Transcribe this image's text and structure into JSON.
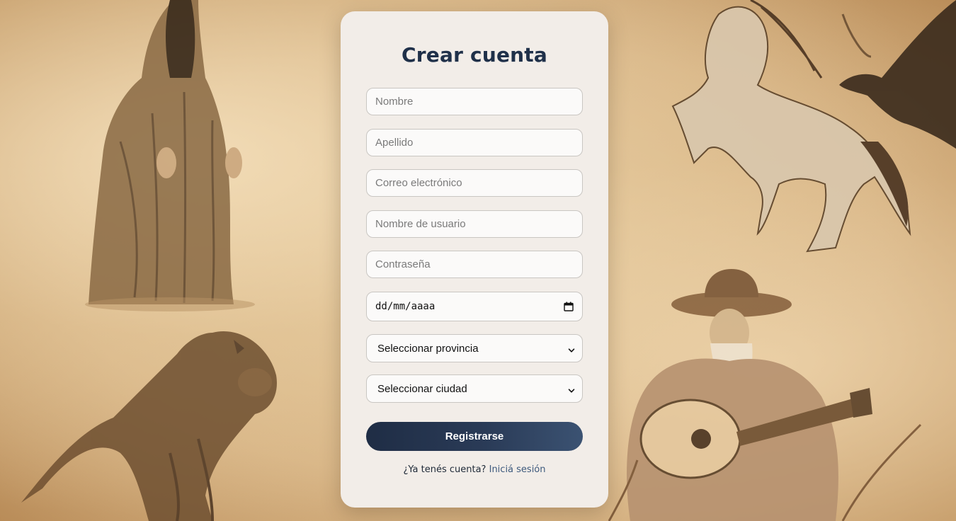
{
  "form": {
    "title": "Crear cuenta",
    "fields": {
      "first_name": {
        "placeholder": "Nombre",
        "value": ""
      },
      "last_name": {
        "placeholder": "Apellido",
        "value": ""
      },
      "email": {
        "placeholder": "Correo electrónico",
        "value": ""
      },
      "username": {
        "placeholder": "Nombre de usuario",
        "value": ""
      },
      "password": {
        "placeholder": "Contraseña",
        "value": ""
      },
      "birth_date": {
        "display": "dd/mm/aaaa",
        "icon": "calendar-icon"
      },
      "province": {
        "selected": "Seleccionar provincia",
        "icon": "chevron-down-icon"
      },
      "city": {
        "selected": "Seleccionar ciudad",
        "icon": "chevron-down-icon"
      }
    },
    "submit_label": "Registrarse",
    "login_prompt": "¿Ya tenés cuenta?",
    "login_link": "Iniciá sesión"
  },
  "theme": {
    "title_color": "#1f3049",
    "button_gradient": [
      "#1f2d45",
      "#3b5272"
    ],
    "link_color": "#3e5a7d",
    "card_background": "#f2ede8",
    "page_background": "#d7b98d"
  },
  "background": {
    "illustrations": [
      "hooded-ghost-illustration",
      "wolf-creature-illustration",
      "horse-illustration",
      "crow-illustration",
      "guitar-player-illustration"
    ]
  }
}
